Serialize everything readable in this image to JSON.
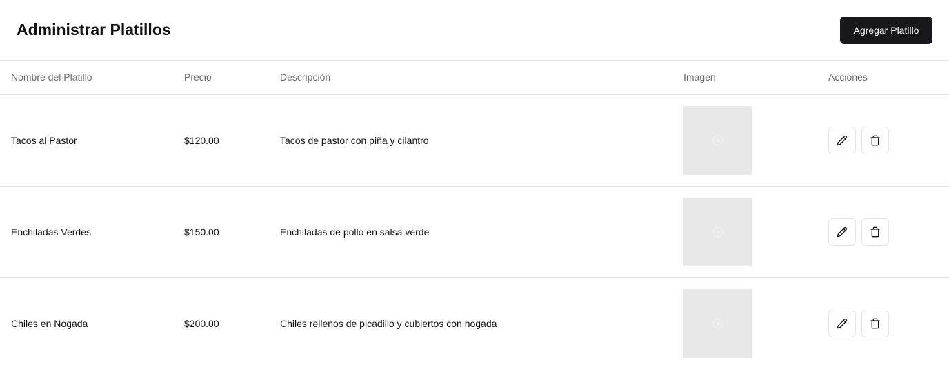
{
  "header": {
    "title": "Administrar Platillos",
    "add_button_label": "Agregar Platillo"
  },
  "table": {
    "columns": [
      "Nombre del Platillo",
      "Precio",
      "Descripción",
      "Imagen",
      "Acciones"
    ],
    "rows": [
      {
        "name": "Tacos al Pastor",
        "price": "$120.00",
        "description": "Tacos de pastor con piña y cilantro",
        "image_icon": "image-placeholder-icon",
        "actions": [
          "edit-icon",
          "trash-icon"
        ]
      },
      {
        "name": "Enchiladas Verdes",
        "price": "$150.00",
        "description": "Enchiladas de pollo en salsa verde",
        "image_icon": "image-placeholder-icon",
        "actions": [
          "edit-icon",
          "trash-icon"
        ]
      },
      {
        "name": "Chiles en Nogada",
        "price": "$200.00",
        "description": "Chiles rellenos de picadillo y cubiertos con nogada",
        "image_icon": "image-placeholder-icon",
        "actions": [
          "edit-icon",
          "trash-icon"
        ]
      }
    ]
  },
  "colors": {
    "primary_button": "#18181b",
    "border": "#e5e5e5",
    "header_text": "#6b6b6b",
    "image_placeholder": "#e8e8e8"
  }
}
